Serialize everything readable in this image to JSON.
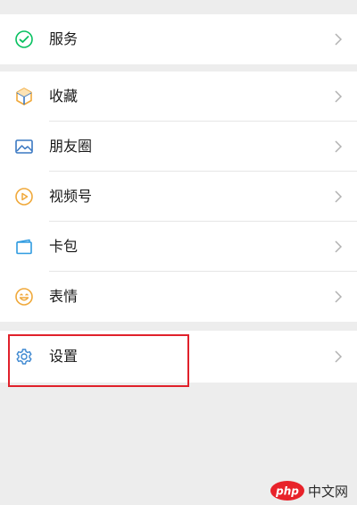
{
  "colors": {
    "background": "#ededed",
    "row_background": "#ffffff",
    "label_text": "#1a1a1a",
    "chevron": "#b2b2b2",
    "divider": "#e6e6e6",
    "highlight": "#e0212b",
    "service_icon": "#07c160",
    "favorites_icon": "#f0a93b",
    "moments_icon": "#3a78c2",
    "channels_icon": "#f0a93b",
    "cards_icon": "#2f9be0",
    "stickers_icon": "#f0a93b",
    "settings_icon": "#3a86d0"
  },
  "groups": [
    {
      "items": [
        {
          "id": "service",
          "label": "服务",
          "icon": "service-check-icon"
        }
      ]
    },
    {
      "items": [
        {
          "id": "favorites",
          "label": "收藏",
          "icon": "cube-icon"
        },
        {
          "id": "moments",
          "label": "朋友圈",
          "icon": "picture-icon"
        },
        {
          "id": "channels",
          "label": "视频号",
          "icon": "play-circle-icon"
        },
        {
          "id": "cards",
          "label": "卡包",
          "icon": "wallet-icon"
        },
        {
          "id": "stickers",
          "label": "表情",
          "icon": "smiley-icon"
        }
      ]
    },
    {
      "items": [
        {
          "id": "settings",
          "label": "设置",
          "icon": "gear-icon",
          "highlighted": true
        }
      ]
    }
  ],
  "watermark": {
    "logo_text": "php",
    "text": "中文网"
  }
}
